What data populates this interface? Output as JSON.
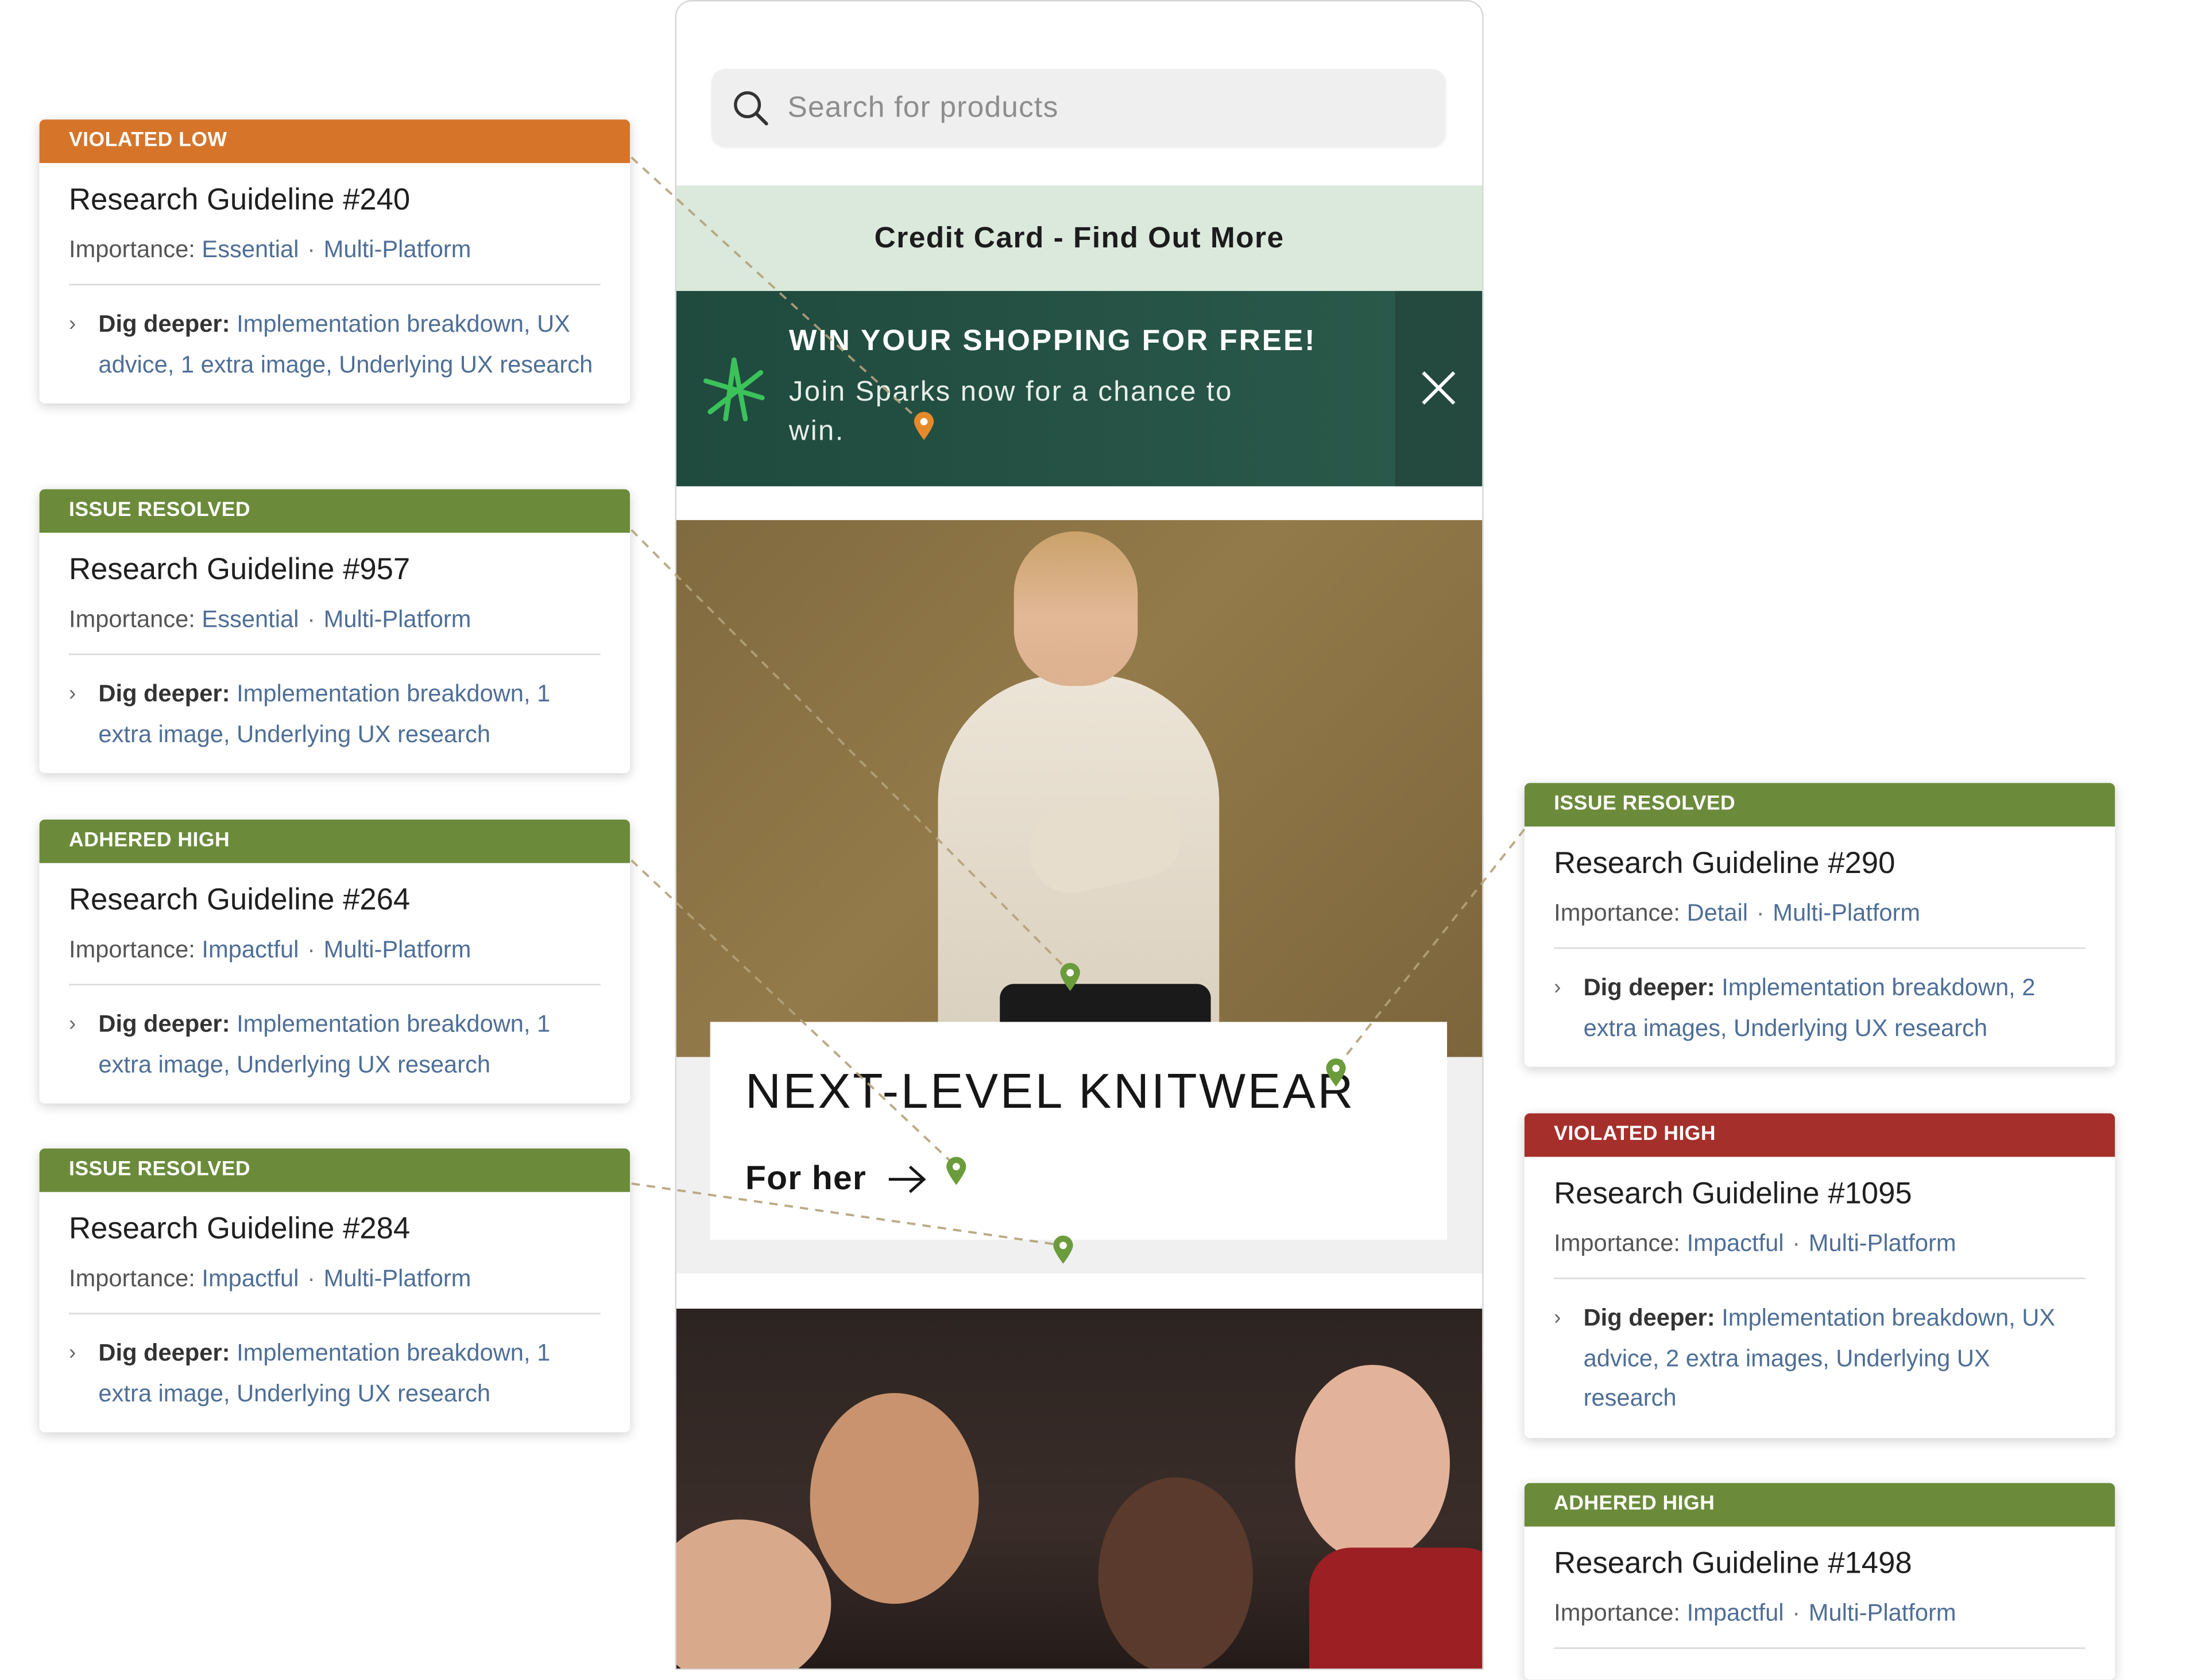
{
  "search": {
    "placeholder": "Search for products"
  },
  "credit_banner": {
    "text": "Credit Card - Find Out More"
  },
  "promo": {
    "headline": "WIN YOUR SHOPPING FOR FREE!",
    "subtext": "Join Sparks now for a chance to win."
  },
  "hero": {
    "title": "NEXT-LEVEL KNITWEAR",
    "cta": "For her"
  },
  "labels": {
    "importance": "Importance:",
    "dig_deeper": "Dig deeper:"
  },
  "colors": {
    "violated_low": "#d6752a",
    "issue_resolved": "#6b8b3b",
    "adhered_high": "#6b8b3b",
    "violated_high": "#a5302b",
    "link": "#4e6e96"
  },
  "cards": [
    {
      "status": "VIOLATED LOW",
      "title": "Research Guideline #240",
      "importance": "Essential",
      "platform": "Multi-Platform",
      "dig": "Implementation breakdown, UX advice, 1 extra image, Underlying UX research"
    },
    {
      "status": "ISSUE RESOLVED",
      "title": "Research Guideline #957",
      "importance": "Essential",
      "platform": "Multi-Platform",
      "dig": "Implementation breakdown, 1 extra image, Underlying UX research"
    },
    {
      "status": "ADHERED HIGH",
      "title": "Research Guideline #264",
      "importance": "Impactful",
      "platform": "Multi-Platform",
      "dig": "Implementation breakdown, 1 extra image, Underlying UX research"
    },
    {
      "status": "ISSUE RESOLVED",
      "title": "Research Guideline #284",
      "importance": "Impactful",
      "platform": "Multi-Platform",
      "dig": "Implementation breakdown, 1 extra image, Underlying UX research"
    },
    {
      "status": "ISSUE RESOLVED",
      "title": "Research Guideline #290",
      "importance": "Detail",
      "platform": "Multi-Platform",
      "dig": "Implementation breakdown, 2 extra images, Underlying UX research"
    },
    {
      "status": "VIOLATED HIGH",
      "title": "Research Guideline #1095",
      "importance": "Impactful",
      "platform": "Multi-Platform",
      "dig": "Implementation breakdown, UX advice, 2 extra images, Underlying UX research"
    },
    {
      "status": "ADHERED HIGH",
      "title": "Research Guideline #1498",
      "importance": "Impactful",
      "platform": "Multi-Platform"
    }
  ]
}
